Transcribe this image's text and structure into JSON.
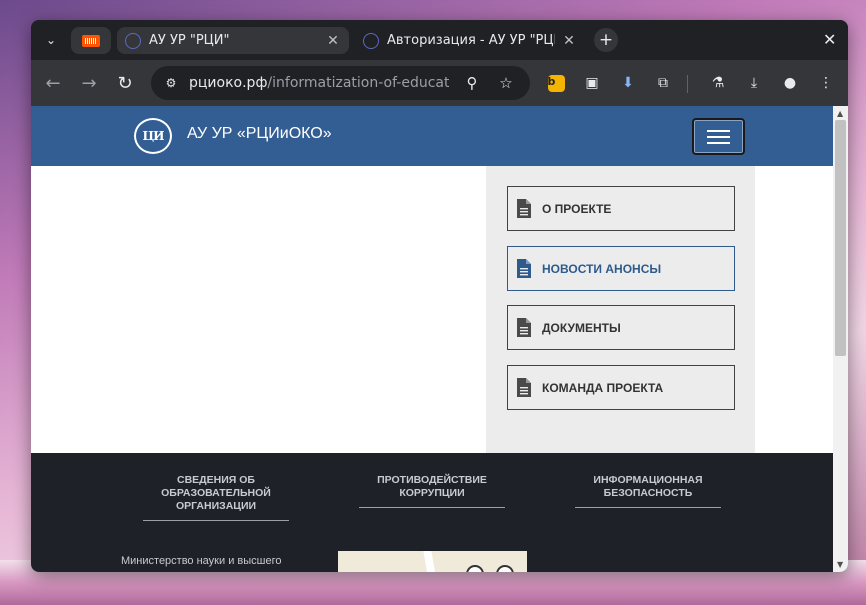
{
  "browser": {
    "tabs": [
      {
        "title": "АУ УР \"РЦИ\"",
        "active": true
      },
      {
        "title": "Авторизация - АУ УР \"РЦИ\"",
        "active": false
      }
    ],
    "url_host": "рциоко.рф",
    "url_path": "/informatization-of-educati..."
  },
  "site": {
    "header_title": "АУ УР «РЦИиОКО»",
    "logo_text": "ЦИ",
    "sidebar_menu": [
      {
        "label": "О ПРОЕКТЕ",
        "highlighted": false
      },
      {
        "label": "НОВОСТИ АНОНСЫ",
        "highlighted": true
      },
      {
        "label": "ДОКУМЕНТЫ",
        "highlighted": false
      },
      {
        "label": "КОМАНДА ПРОЕКТА",
        "highlighted": false
      }
    ],
    "footer_columns": [
      {
        "label": "СВЕДЕНИЯ ОБ ОБРАЗОВАТЕЛЬНОЙ ОРГАНИЗАЦИИ"
      },
      {
        "label": "ПРОТИВОДЕЙСТВИЕ КОРРУПЦИИ"
      },
      {
        "label": "ИНФОРМАЦИОННАЯ БЕЗОПАСНОСТЬ"
      }
    ],
    "footer_ministry": "Министерство науки и высшего"
  },
  "colors": {
    "header_bg": "#325e94",
    "footer_bg": "#1f2129",
    "sidebar_bg": "#ececec",
    "highlight": "#2e5a8c"
  }
}
